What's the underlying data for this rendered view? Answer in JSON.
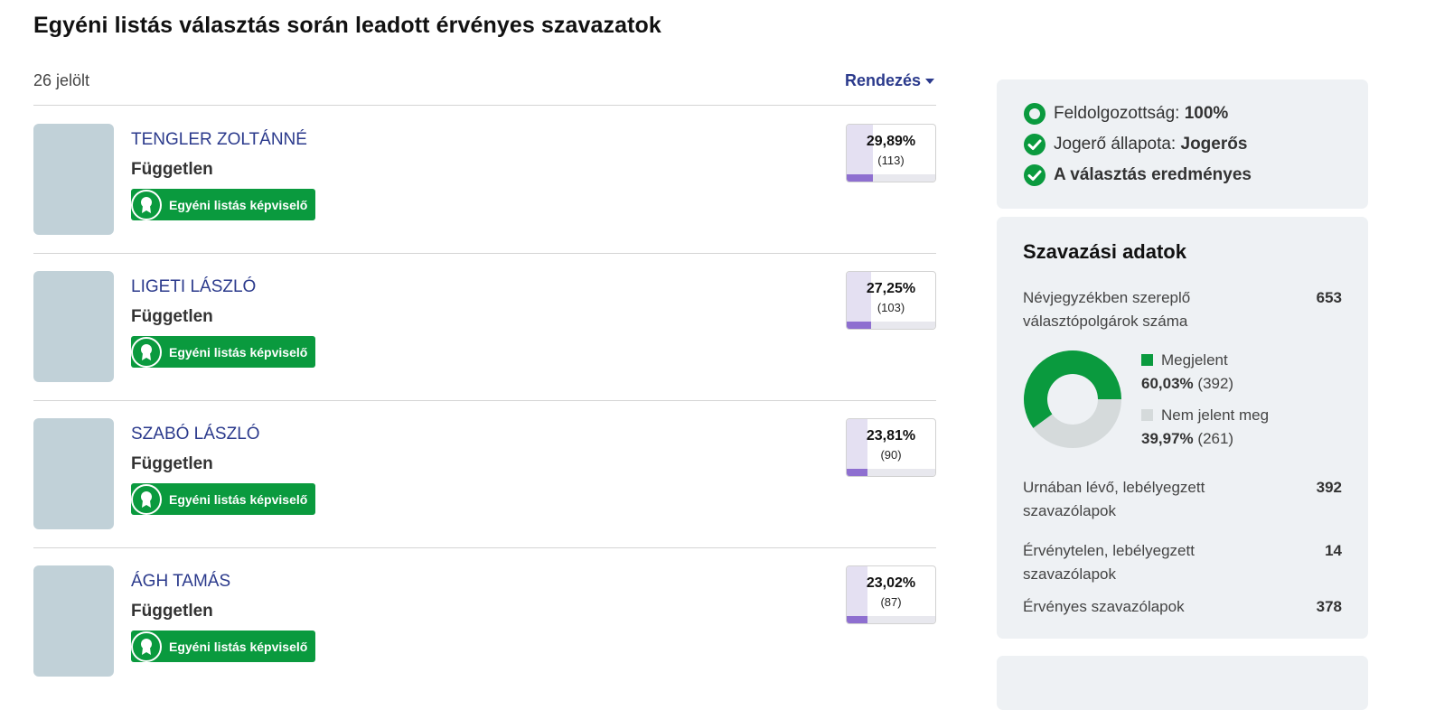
{
  "page": {
    "title": "Egyéni listás választás során leadott érvényes szavazatok"
  },
  "list": {
    "candidate_count": "26 jelölt",
    "sort_label": "Rendezés"
  },
  "candidates": [
    {
      "name": "TENGLER ZOLTÁNNÉ",
      "party": "Független",
      "badge": "Egyéni listás képviselő",
      "percent": "29,89%",
      "votes": "(113)",
      "share": 29.89
    },
    {
      "name": "LIGETI LÁSZLÓ",
      "party": "Független",
      "badge": "Egyéni listás képviselő",
      "percent": "27,25%",
      "votes": "(103)",
      "share": 27.25
    },
    {
      "name": "SZABÓ LÁSZLÓ",
      "party": "Független",
      "badge": "Egyéni listás képviselő",
      "percent": "23,81%",
      "votes": "(90)",
      "share": 23.81
    },
    {
      "name": "ÁGH TAMÁS",
      "party": "Független",
      "badge": "Egyéni listás képviselő",
      "percent": "23,02%",
      "votes": "(87)",
      "share": 23.02
    }
  ],
  "status": {
    "processing_label": "Feldolgozottság:",
    "processing_value": "100%",
    "legal_label": "Jogerő állapota:",
    "legal_value": "Jogerős",
    "result_text": "A választás eredményes"
  },
  "voting": {
    "title": "Szavazási adatok",
    "registered_label": "Névjegyzékben szereplő választópolgárok száma",
    "registered_value": "653",
    "turnout": {
      "present_label": "Megjelent",
      "present_percent": "60,03%",
      "present_count": "(392)",
      "present_share": 60.03,
      "absent_label": "Nem jelent meg",
      "absent_percent": "39,97%",
      "absent_count": "(261)",
      "absent_share": 39.97,
      "present_color": "#0a9a3e",
      "absent_color": "#d5dadb"
    },
    "ballots_in_urn_label": "Urnában lévő, lebélyegzett szavazólapok",
    "ballots_in_urn_value": "392",
    "invalid_label": "Érvénytelen, lebélyegzett szavazólapok",
    "invalid_value": "14",
    "valid_label": "Érvényes szavazólapok",
    "valid_value": "378"
  },
  "colors": {
    "accent_blue": "#2b3a8c",
    "badge_green": "#0a9a3e",
    "bar_purple": "#8e6fd0"
  },
  "icons": {
    "badge": "award-ribbon-icon",
    "processing": "ring-icon",
    "check": "check-circle-icon",
    "sort": "caret-down-icon"
  }
}
